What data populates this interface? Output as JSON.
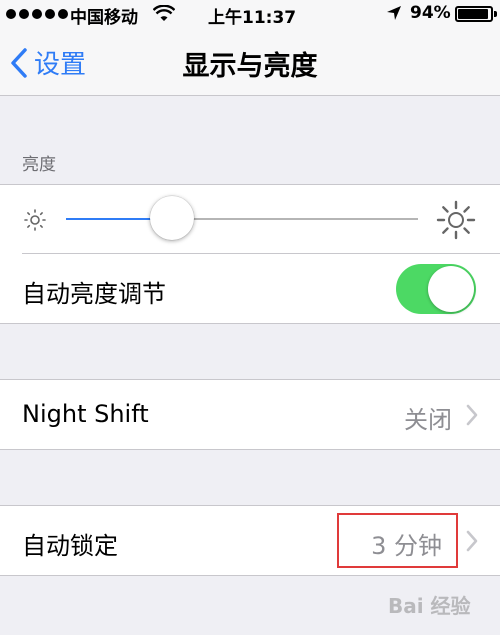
{
  "status_bar": {
    "carrier": "中国移动",
    "time": "上午11:37",
    "battery_percent": "94%",
    "battery_level": 0.94
  },
  "nav": {
    "back_label": "设置",
    "title": "显示与亮度"
  },
  "brightness_section": {
    "header": "亮度",
    "slider_level": 0.3,
    "auto_brightness_label": "自动亮度调节",
    "auto_brightness_on": true
  },
  "night_shift": {
    "label": "Night Shift",
    "value": "关闭"
  },
  "auto_lock": {
    "label": "自动锁定",
    "value": "3 分钟"
  },
  "colors": {
    "accent": "#2f7cf6",
    "toggle_on": "#4cd964",
    "highlight": "#e03a3a"
  },
  "watermark": "Bai 经验"
}
